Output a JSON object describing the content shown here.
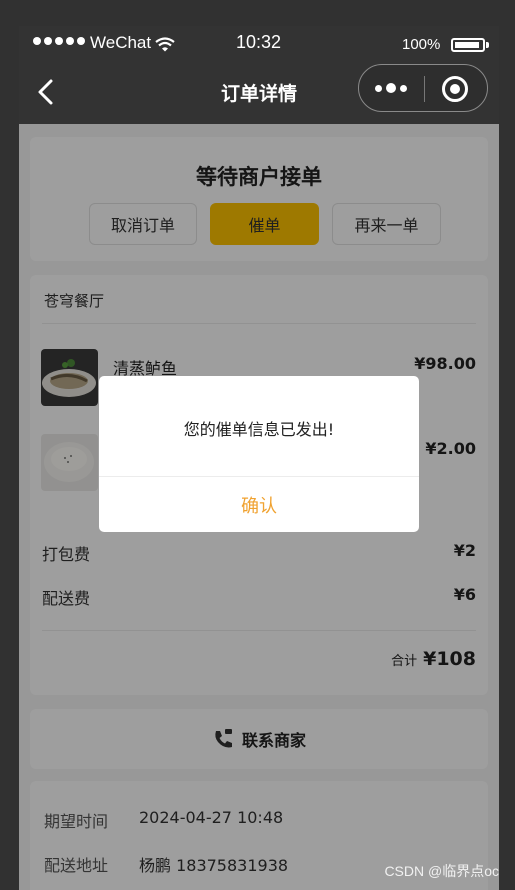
{
  "statusbar": {
    "carrier": "WeChat",
    "time": "10:32",
    "battery": "100%"
  },
  "navbar": {
    "title": "订单详情"
  },
  "order_status": {
    "title": "等待商户接单",
    "buttons": {
      "cancel": "取消订单",
      "urge": "催单",
      "reorder": "再来一单"
    }
  },
  "order": {
    "shop_name": "苍穹餐厅",
    "items": [
      {
        "name": "清蒸鲈鱼",
        "price": "¥98.00"
      },
      {
        "name": "",
        "price": "¥2.00"
      }
    ],
    "fees": [
      {
        "label": "打包费",
        "value": "¥2"
      },
      {
        "label": "配送费",
        "value": "¥6"
      }
    ],
    "total_label": "合计",
    "total_value": "¥108"
  },
  "contact": {
    "label": "联系商家"
  },
  "info": {
    "expected_time_label": "期望时间",
    "expected_time": "2024-04-27 10:48",
    "address_label": "配送地址",
    "recipient": "杨鹏  18375831938"
  },
  "dialog": {
    "message": "您的催单信息已发出!",
    "confirm": "确认"
  },
  "watermark": "CSDN @临界点oc",
  "colors": {
    "accent": "#ffc300",
    "confirm": "#f0a230",
    "bar": "#333333"
  }
}
